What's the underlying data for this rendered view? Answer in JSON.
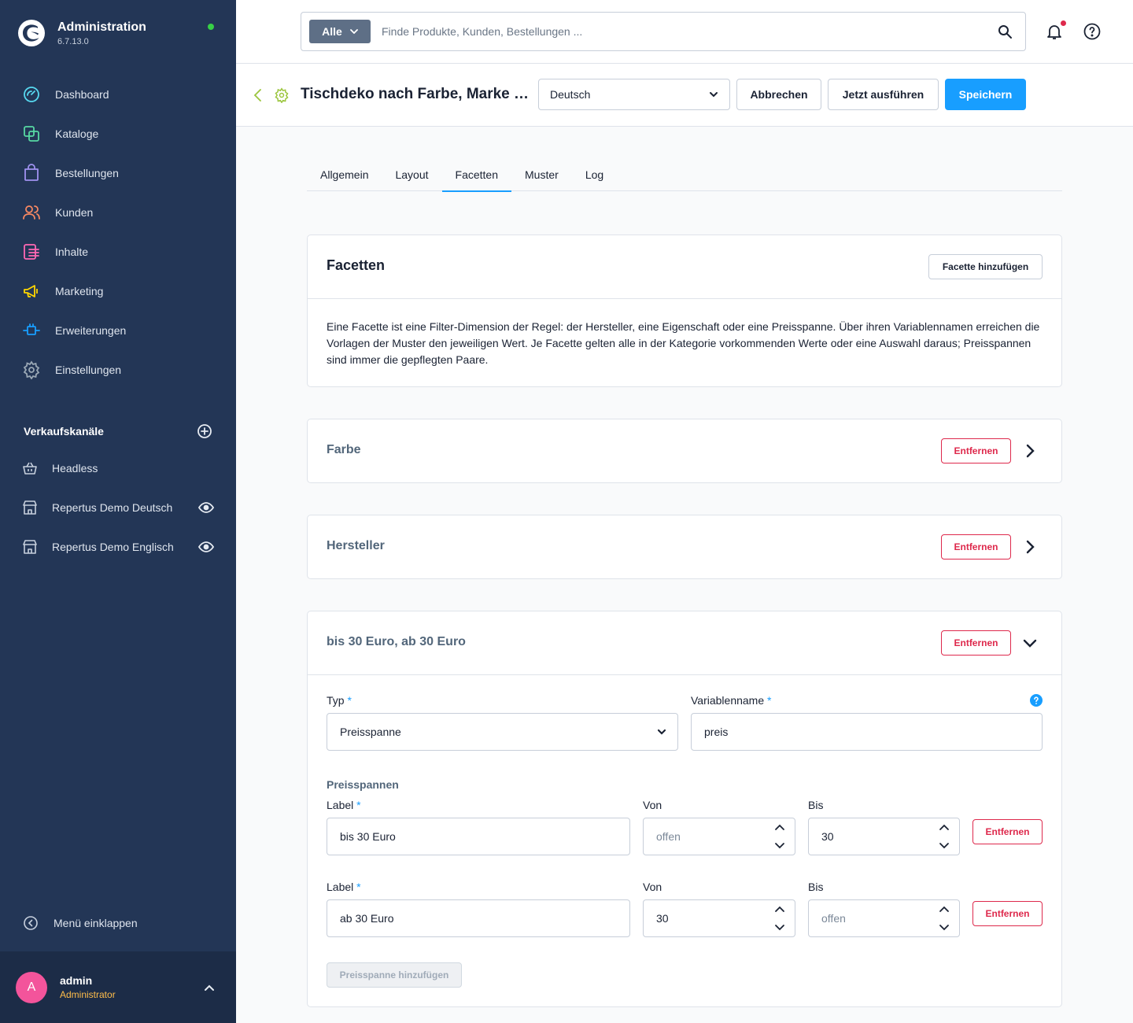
{
  "app": {
    "title": "Administration",
    "version": "6.7.13.0"
  },
  "colors": {
    "sidebar": "#233656",
    "accent": "#189eff",
    "danger": "#de294c",
    "online": "#37d046"
  },
  "nav": [
    {
      "label": "Dashboard",
      "icon": "dashboard-icon",
      "color": "#57d9f0"
    },
    {
      "label": "Kataloge",
      "icon": "catalog-icon",
      "color": "#57d9a3"
    },
    {
      "label": "Bestellungen",
      "icon": "shopping-bag-icon",
      "color": "#a092f0"
    },
    {
      "label": "Kunden",
      "icon": "users-icon",
      "color": "#f88962"
    },
    {
      "label": "Inhalte",
      "icon": "content-icon",
      "color": "#ff68b4"
    },
    {
      "label": "Marketing",
      "icon": "megaphone-icon",
      "color": "#ffd700"
    },
    {
      "label": "Erweiterungen",
      "icon": "plug-icon",
      "color": "#189eff"
    },
    {
      "label": "Einstellungen",
      "icon": "gear-icon",
      "color": "#9aa8b5"
    }
  ],
  "sales_channels": {
    "title": "Verkaufskanäle",
    "items": [
      {
        "label": "Headless",
        "icon": "basket-icon"
      },
      {
        "label": "Repertus Demo Deutsch",
        "icon": "storefront-icon"
      },
      {
        "label": "Repertus Demo Englisch",
        "icon": "storefront-icon"
      }
    ]
  },
  "collapse_label": "Menü einklappen",
  "user": {
    "initial": "A",
    "name": "admin",
    "role": "Administrator"
  },
  "search": {
    "filter": "Alle",
    "placeholder": "Finde Produkte, Kunden, Bestellungen ..."
  },
  "smartbar": {
    "title": "Tischdeko nach Farbe, Marke und Preis",
    "language": "Deutsch",
    "cancel": "Abbrechen",
    "run": "Jetzt ausführen",
    "save": "Speichern"
  },
  "tabs": [
    {
      "label": "Allgemein",
      "active": false
    },
    {
      "label": "Layout",
      "active": false
    },
    {
      "label": "Facetten",
      "active": true
    },
    {
      "label": "Muster",
      "active": false
    },
    {
      "label": "Log",
      "active": false
    }
  ],
  "facets_card": {
    "title": "Facetten",
    "add_button": "Facette hinzufügen",
    "description": "Eine Facette ist eine Filter-Dimension der Regel: der Hersteller, eine Eigenschaft oder eine Preisspanne. Über ihren Variablennamen erreichen die Vorlagen der Muster den jeweiligen Wert. Je Facette gelten alle in der Kategorie vorkommenden Werte oder eine Auswahl daraus; Preisspannen sind immer die gepflegten Paare."
  },
  "remove_label": "Entfernen",
  "facets": [
    {
      "title": "Farbe",
      "expanded": false
    },
    {
      "title": "Hersteller",
      "expanded": false
    },
    {
      "title": "bis 30 Euro, ab 30 Euro",
      "expanded": true
    }
  ],
  "price_facet": {
    "type_label": "Typ",
    "type_value": "Preisspanne",
    "varname_label": "Variablenname",
    "varname_value": "preis",
    "ranges_label": "Preisspannen",
    "label_label": "Label",
    "from_label": "Von",
    "to_label": "Bis",
    "open_placeholder": "offen",
    "ranges": [
      {
        "label": "bis 30 Euro",
        "from": "",
        "to": "30"
      },
      {
        "label": "ab 30 Euro",
        "from": "30",
        "to": ""
      }
    ],
    "add_range": "Preisspanne hinzufügen"
  }
}
